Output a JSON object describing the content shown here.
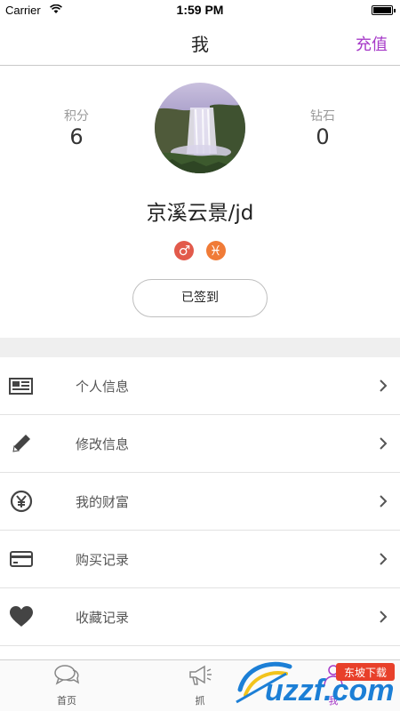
{
  "status_bar": {
    "carrier": "Carrier",
    "time": "1:59 PM"
  },
  "nav": {
    "title": "我",
    "right_action": "充值"
  },
  "profile": {
    "points_label": "积分",
    "points_value": "6",
    "diamonds_label": "钻石",
    "diamonds_value": "0",
    "user_name": "京溪云景/jd",
    "gender_symbol": "♂",
    "zodiac_symbol": "♓",
    "checkin_label": "已签到"
  },
  "menu": {
    "items": [
      {
        "label": "个人信息",
        "icon": "newspaper-icon"
      },
      {
        "label": "修改信息",
        "icon": "pencil-icon"
      },
      {
        "label": "我的财富",
        "icon": "yen-coin-icon"
      },
      {
        "label": "购买记录",
        "icon": "credit-card-icon"
      },
      {
        "label": "收藏记录",
        "icon": "heart-icon"
      }
    ]
  },
  "tabs": [
    {
      "label": "首页",
      "icon": "chat-bubbles-icon"
    },
    {
      "label": "抓",
      "icon": "megaphone-icon"
    },
    {
      "label": "我",
      "icon": "person-icon"
    }
  ],
  "watermark": {
    "text": "uzzf.com",
    "badge": "东坡下载"
  },
  "colors": {
    "accent": "#a63ac8",
    "gender": "#e25a4b",
    "zodiac": "#f07b37"
  }
}
